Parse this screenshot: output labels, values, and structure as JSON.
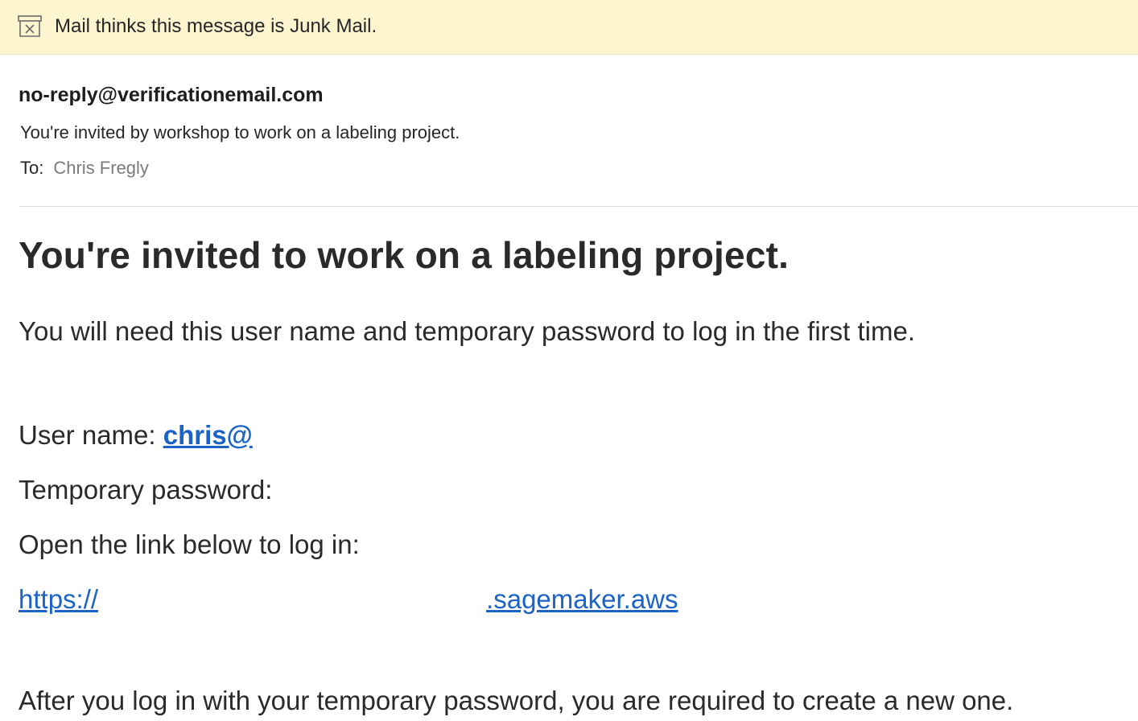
{
  "junk_banner": {
    "icon": "junk-tray-icon",
    "message": "Mail thinks this message is Junk Mail."
  },
  "header": {
    "sender": "no-reply@verificationemail.com",
    "subject": "You're invited by workshop to work on a labeling project.",
    "to_label": "To:",
    "to_value": "Chris Fregly"
  },
  "body": {
    "headline": "You're invited to work on a labeling project.",
    "intro": "You will need this user name and temporary password to log in the first time.",
    "username_label": "User name:",
    "username_value": "chris@",
    "password_label": "Temporary password:",
    "open_link_text": "Open the link below to log in:",
    "url_prefix": "https://",
    "url_suffix": ".sagemaker.aws",
    "outro": "After you log in with your temporary password, you are required to create a new one."
  },
  "colors": {
    "banner_bg": "#fdf5cf",
    "link": "#1b63c6",
    "text": "#2a2a2a",
    "muted": "#7b7b7b"
  }
}
